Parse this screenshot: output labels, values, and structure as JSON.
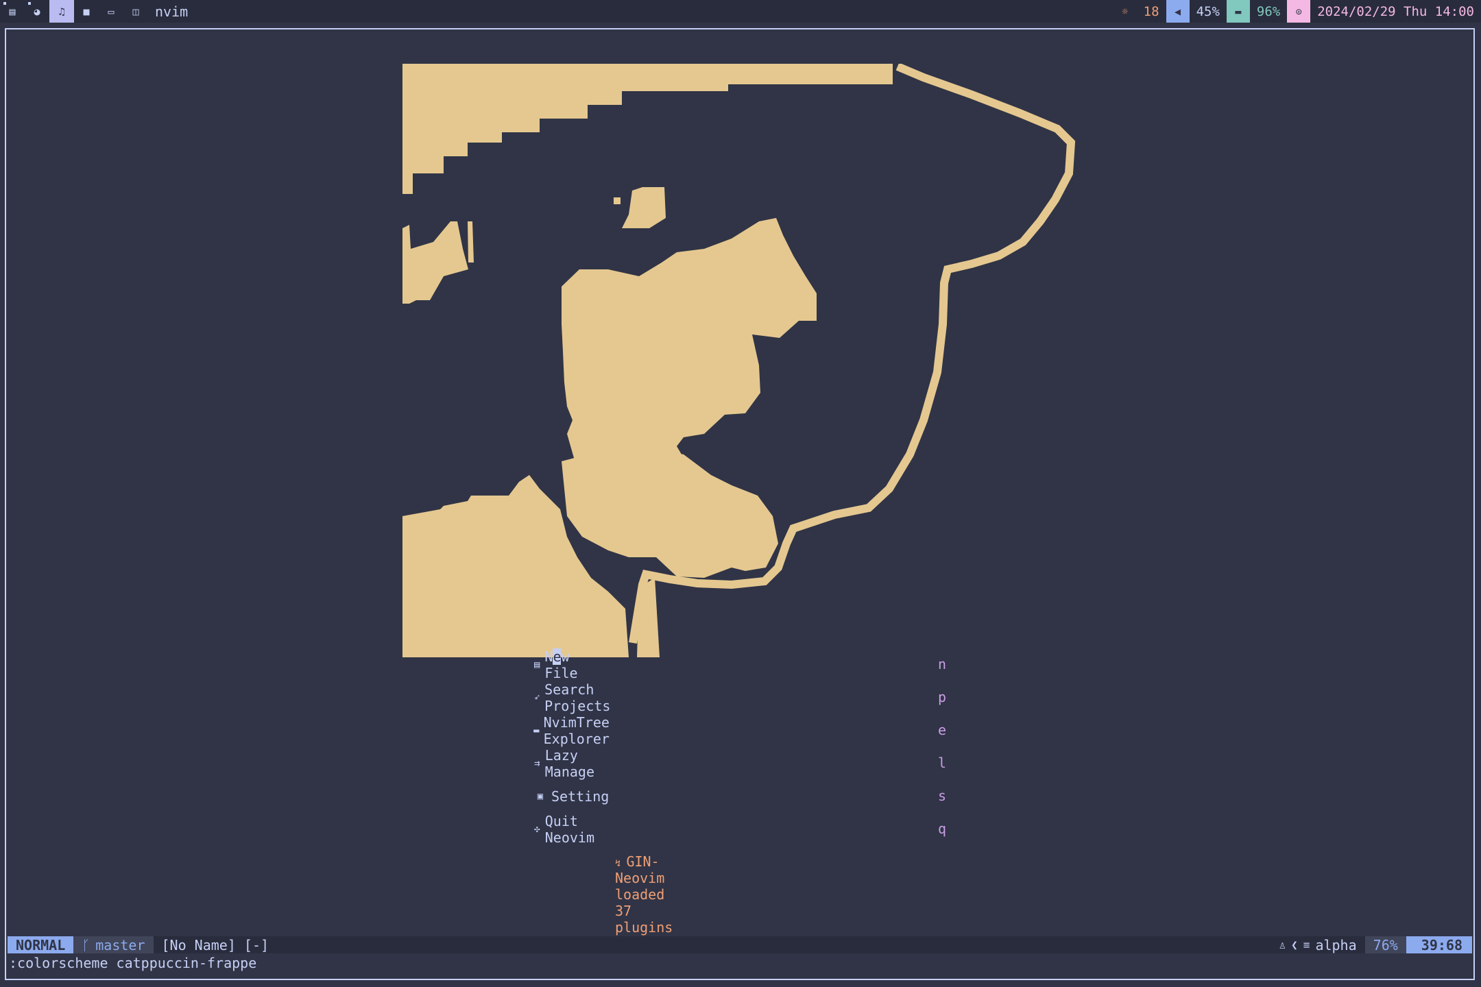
{
  "topbar": {
    "workspaces": [
      {
        "icon": "terminal-icon",
        "glyph": "▤",
        "active": false
      },
      {
        "icon": "firefox-icon",
        "glyph": "◕",
        "active": false
      },
      {
        "icon": "music-icon",
        "glyph": "♫",
        "active": true
      },
      {
        "icon": "video-icon",
        "glyph": "■",
        "active": false
      },
      {
        "icon": "laptop-icon",
        "glyph": "▭",
        "active": false
      },
      {
        "icon": "window-icon",
        "glyph": "◫",
        "active": false
      }
    ],
    "window_title": "nvim",
    "brightness": "18",
    "volume": "45%",
    "battery": "96%",
    "datetime": "2024/02/29 Thu 14:00"
  },
  "dashboard": {
    "menu": [
      {
        "icon": "file-icon",
        "glyph": "▤",
        "label": "New File",
        "key": "n"
      },
      {
        "icon": "rocket-icon",
        "glyph": "➶",
        "label": "Search Projects",
        "key": "p"
      },
      {
        "icon": "folder-icon",
        "glyph": "▬",
        "label": "NvimTree Explorer",
        "key": "e"
      },
      {
        "icon": "plugin-icon",
        "glyph": "⇉",
        "label": "Lazy Manage",
        "key": "l"
      },
      {
        "icon": "settings-icon",
        "glyph": "▣",
        "label": "Setting",
        "key": "s"
      },
      {
        "icon": "quit-icon",
        "glyph": "✣",
        "label": "Quit Neovim",
        "key": "q"
      }
    ],
    "footer": "GIN-Neovim loaded 37 plugins",
    "art_color": "#e5c890"
  },
  "statusline": {
    "mode": "NORMAL",
    "branch": "master",
    "filename": "[No Name] [-]",
    "filetype": "alpha",
    "progress": "76%",
    "position": "39:68"
  },
  "cmdline": ":colorscheme catppuccin-frappe",
  "colors": {
    "base": "#303446",
    "mantle": "#292c3c",
    "text": "#c6d0f5",
    "blue": "#8caaee",
    "peach": "#ef9f76",
    "mauve": "#ca9ee6",
    "teal": "#81c8be",
    "pink": "#f4b8e4",
    "yellow": "#e5c890"
  }
}
